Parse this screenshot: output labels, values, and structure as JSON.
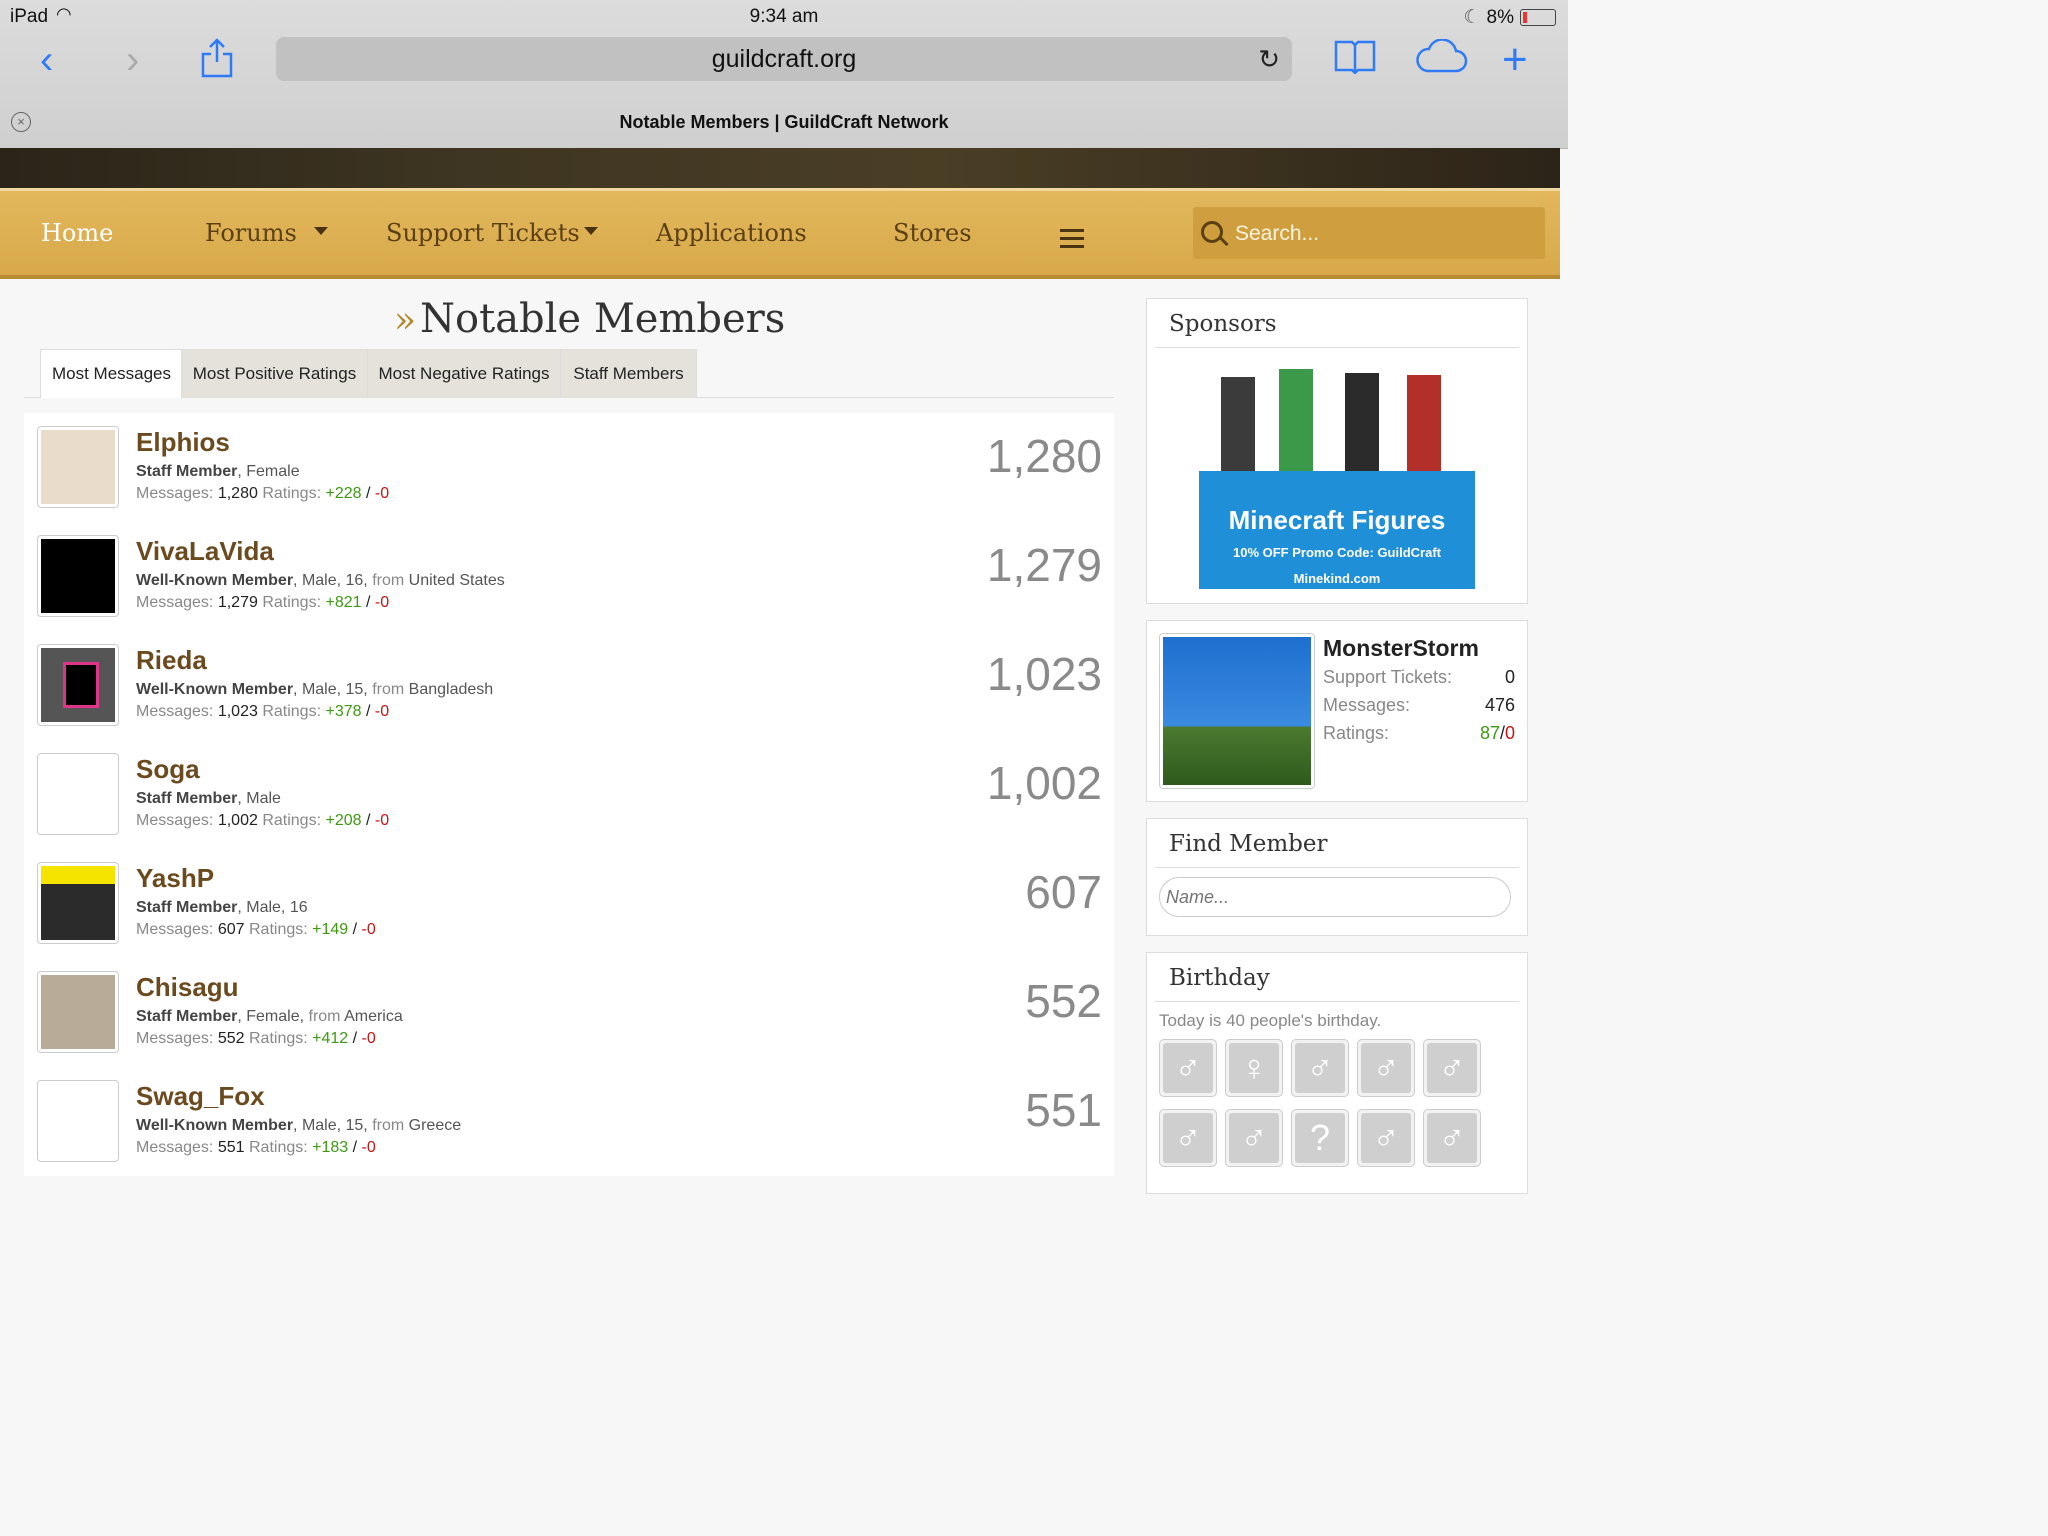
{
  "status_bar": {
    "device": "iPad",
    "time": "9:34 am",
    "battery": "8%"
  },
  "browser": {
    "url": "guildcraft.org",
    "tab_title": "Notable Members | GuildCraft Network"
  },
  "nav": {
    "items": [
      "Home",
      "Forums",
      "Support Tickets",
      "Applications",
      "Stores"
    ],
    "search_placeholder": "Search..."
  },
  "page": {
    "title": "Notable Members",
    "tabs": [
      "Most Messages",
      "Most Positive Ratings",
      "Most Negative Ratings",
      "Staff Members"
    ]
  },
  "labels": {
    "messages": "Messages:",
    "ratings": "Ratings:",
    "from": "from"
  },
  "members": [
    {
      "name": "Elphios",
      "role": "Staff Member",
      "details": ", Female",
      "from": "",
      "messages": "1,280",
      "pos": "+228",
      "neg": "-0",
      "count": "1,280",
      "avatar": "#e9dccb"
    },
    {
      "name": "VivaLaVida",
      "role": "Well-Known Member",
      "details": ", Male, 16,",
      "from": "United States",
      "messages": "1,279",
      "pos": "+821",
      "neg": "-0",
      "count": "1,279",
      "avatar": "#000000"
    },
    {
      "name": "Rieda",
      "role": "Well-Known Member",
      "details": ", Male, 15,",
      "from": "Bangladesh",
      "messages": "1,023",
      "pos": "+378",
      "neg": "-0",
      "count": "1,023",
      "avatar": "#555555"
    },
    {
      "name": "Soga",
      "role": "Staff Member",
      "details": ", Male",
      "from": "",
      "messages": "1,002",
      "pos": "+208",
      "neg": "-0",
      "count": "1,002",
      "avatar": "#ffffff"
    },
    {
      "name": "YashP",
      "role": "Staff Member",
      "details": ", Male, 16",
      "from": "",
      "messages": "607",
      "pos": "+149",
      "neg": "-0",
      "count": "607",
      "avatar": "#2b2b2b"
    },
    {
      "name": "Chisagu",
      "role": "Staff Member",
      "details": ", Female,",
      "from": "America",
      "messages": "552",
      "pos": "+412",
      "neg": "-0",
      "count": "552",
      "avatar": "#b8ac98"
    },
    {
      "name": "Swag_Fox",
      "role": "Well-Known Member",
      "details": ", Male, 15,",
      "from": "Greece",
      "messages": "551",
      "pos": "+183",
      "neg": "-0",
      "count": "551",
      "avatar": "#ffffff"
    }
  ],
  "sidebar": {
    "sponsors": {
      "title": "Sponsors",
      "ad_title": "Minecraft Figures",
      "ad_promo": "10% OFF Promo Code: GuildCraft",
      "ad_site": "Minekind.com"
    },
    "user": {
      "name": "MonsterStorm",
      "tickets_label": "Support Tickets:",
      "tickets": "0",
      "messages_label": "Messages:",
      "messages": "476",
      "ratings_label": "Ratings:",
      "ratings_pos": "87",
      "ratings_neg": "0"
    },
    "find_member": {
      "title": "Find Member",
      "placeholder": "Name..."
    },
    "birthday": {
      "title": "Birthday",
      "text": "Today is 40 people's birthday.",
      "icons": [
        "♂",
        "♀",
        "♂",
        "♂",
        "♂",
        "♂",
        "♂",
        "?",
        "♂",
        "♂"
      ]
    }
  },
  "colors": {
    "nav_gold": "#d7a94a",
    "link_brown": "#6a4a1e",
    "positive": "#3e9a12",
    "negative": "#c31616",
    "ios_blue": "#2f7bf5"
  }
}
